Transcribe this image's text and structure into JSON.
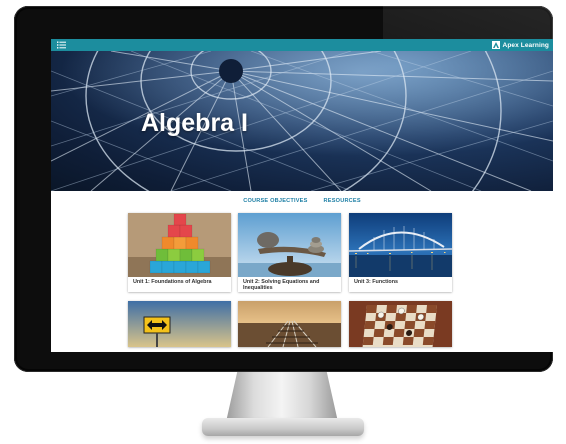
{
  "app": {
    "brand": "Apex Learning",
    "menu_icon": "hamburger-list-icon",
    "brand_icon": "apex-logo-icon",
    "topbar_color": "#1c8d9e"
  },
  "hero": {
    "title": "Algebra I"
  },
  "subnav": {
    "links": [
      "COURSE OBJECTIVES",
      "RESOURCES"
    ],
    "link_color": "#1e7fa5"
  },
  "units": [
    {
      "label": "Unit 1: Foundations of Algebra",
      "image": "stacked-colored-blocks"
    },
    {
      "label": "Unit 2: Solving Equations and Inequalities",
      "image": "balancing-stones"
    },
    {
      "label": "Unit 3: Functions",
      "image": "arch-bridge-at-dusk"
    },
    {
      "label": "",
      "image": "road-sign-arrows"
    },
    {
      "label": "",
      "image": "railroad-tracks"
    },
    {
      "label": "",
      "image": "chessboard"
    }
  ]
}
